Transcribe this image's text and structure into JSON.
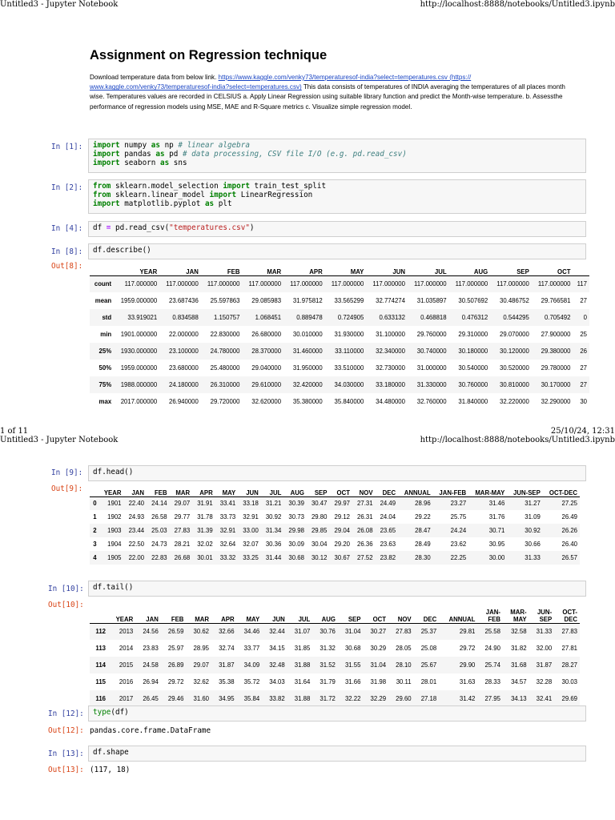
{
  "page1": {
    "header_left": "Untitled3 - Jupyter Notebook",
    "header_right": "http://localhost:8888/notebooks/Untitled3.ipynb",
    "footer_left": "1 of 11",
    "footer_right": "25/10/24, 12:31"
  },
  "page2": {
    "header_left": "Untitled3 - Jupyter Notebook",
    "header_right": "http://localhost:8888/notebooks/Untitled3.ipynb"
  },
  "markdown": {
    "title": "Assignment on Regression technique",
    "desc_prefix": "Download temperature data from below link. ",
    "link1": "https://www.kaggle.com/venky73/temperaturesof-india?select=temperatures.csv (https://",
    "link2": "www.kaggle.com/venky73/temperaturesof-india?select=temperatures.csv)",
    "desc_suffix": " This data consists of temperatures of INDIA averaging the temperatures of all places month wise. Temperatures values are recorded in CELSIUS a. Apply Linear Regression using suitable library function and predict the Month-wise temperature. b. Assessthe performance of regression models using MSE, MAE and R-Square metrics c. Visualize simple regression model."
  },
  "prompts": {
    "in1": "In [1]:",
    "in2": "In [2]:",
    "in4": "In [4]:",
    "in8": "In [8]:",
    "out8": "Out[8]:",
    "in9": "In [9]:",
    "out9": "Out[9]:",
    "in10": "In [10]:",
    "out10": "Out[10]:",
    "in12": "In [12]:",
    "out12": "Out[12]:",
    "in13": "In [13]:",
    "out13": "Out[13]:"
  },
  "code": {
    "c1": [
      {
        "kw1": "import",
        "a": " numpy ",
        "kw2": "as",
        "b": " np ",
        "comment": "# linear algebra"
      },
      {
        "kw1": "import",
        "a": " pandas ",
        "kw2": "as",
        "b": " pd ",
        "comment": "# data processing, CSV file I/O (e.g. pd.read_csv)"
      },
      {
        "kw1": "import",
        "a": " seaborn ",
        "kw2": "as",
        "b": " sns",
        "comment": ""
      }
    ],
    "c2": [
      {
        "kw1": "from",
        "a": " sklearn.model_selection ",
        "kw2": "import",
        "b": " train_test_split"
      },
      {
        "kw1": "from",
        "a": " sklearn.linear_model ",
        "kw2": "import",
        "b": " LinearRegression"
      },
      {
        "kw1": "import",
        "a": " matplotlib.pyplot ",
        "kw2": "as",
        "b": " plt"
      }
    ],
    "c4_a": "df ",
    "c4_op": "=",
    "c4_b": " pd.read_csv(",
    "c4_str": "\"temperatures.csv\"",
    "c4_c": ")",
    "c8": "df.describe()",
    "c9": "df.head()",
    "c10": "df.tail()",
    "c12_fn": "type",
    "c12_b": "(df)",
    "c13": "df.shape"
  },
  "outputs": {
    "out12": "pandas.core.frame.DataFrame",
    "out13": "(117, 18)"
  },
  "describe": {
    "columns": [
      "",
      "YEAR",
      "JAN",
      "FEB",
      "MAR",
      "APR",
      "MAY",
      "JUN",
      "JUL",
      "AUG",
      "SEP",
      "OCT",
      ""
    ],
    "rows": [
      [
        "count",
        "117.000000",
        "117.000000",
        "117.000000",
        "117.000000",
        "117.000000",
        "117.000000",
        "117.000000",
        "117.000000",
        "117.000000",
        "117.000000",
        "117.000000",
        "117"
      ],
      [
        "mean",
        "1959.000000",
        "23.687436",
        "25.597863",
        "29.085983",
        "31.975812",
        "33.565299",
        "32.774274",
        "31.035897",
        "30.507692",
        "30.486752",
        "29.766581",
        "27"
      ],
      [
        "std",
        "33.919021",
        "0.834588",
        "1.150757",
        "1.068451",
        "0.889478",
        "0.724905",
        "0.633132",
        "0.468818",
        "0.476312",
        "0.544295",
        "0.705492",
        "0"
      ],
      [
        "min",
        "1901.000000",
        "22.000000",
        "22.830000",
        "26.680000",
        "30.010000",
        "31.930000",
        "31.100000",
        "29.760000",
        "29.310000",
        "29.070000",
        "27.900000",
        "25"
      ],
      [
        "25%",
        "1930.000000",
        "23.100000",
        "24.780000",
        "28.370000",
        "31.460000",
        "33.110000",
        "32.340000",
        "30.740000",
        "30.180000",
        "30.120000",
        "29.380000",
        "26"
      ],
      [
        "50%",
        "1959.000000",
        "23.680000",
        "25.480000",
        "29.040000",
        "31.950000",
        "33.510000",
        "32.730000",
        "31.000000",
        "30.540000",
        "30.520000",
        "29.780000",
        "27"
      ],
      [
        "75%",
        "1988.000000",
        "24.180000",
        "26.310000",
        "29.610000",
        "32.420000",
        "34.030000",
        "33.180000",
        "31.330000",
        "30.760000",
        "30.810000",
        "30.170000",
        "27"
      ],
      [
        "max",
        "2017.000000",
        "26.940000",
        "29.720000",
        "32.620000",
        "35.380000",
        "35.840000",
        "34.480000",
        "32.760000",
        "31.840000",
        "32.220000",
        "32.290000",
        "30"
      ]
    ]
  },
  "head": {
    "columns": [
      "",
      "YEAR",
      "JAN",
      "FEB",
      "MAR",
      "APR",
      "MAY",
      "JUN",
      "JUL",
      "AUG",
      "SEP",
      "OCT",
      "NOV",
      "DEC",
      "ANNUAL",
      "JAN-FEB",
      "MAR-MAY",
      "JUN-SEP",
      "OCT-DEC"
    ],
    "rows": [
      [
        "0",
        "1901",
        "22.40",
        "24.14",
        "29.07",
        "31.91",
        "33.41",
        "33.18",
        "31.21",
        "30.39",
        "30.47",
        "29.97",
        "27.31",
        "24.49",
        "28.96",
        "23.27",
        "31.46",
        "31.27",
        "27.25"
      ],
      [
        "1",
        "1902",
        "24.93",
        "26.58",
        "29.77",
        "31.78",
        "33.73",
        "32.91",
        "30.92",
        "30.73",
        "29.80",
        "29.12",
        "26.31",
        "24.04",
        "29.22",
        "25.75",
        "31.76",
        "31.09",
        "26.49"
      ],
      [
        "2",
        "1903",
        "23.44",
        "25.03",
        "27.83",
        "31.39",
        "32.91",
        "33.00",
        "31.34",
        "29.98",
        "29.85",
        "29.04",
        "26.08",
        "23.65",
        "28.47",
        "24.24",
        "30.71",
        "30.92",
        "26.26"
      ],
      [
        "3",
        "1904",
        "22.50",
        "24.73",
        "28.21",
        "32.02",
        "32.64",
        "32.07",
        "30.36",
        "30.09",
        "30.04",
        "29.20",
        "26.36",
        "23.63",
        "28.49",
        "23.62",
        "30.95",
        "30.66",
        "26.40"
      ],
      [
        "4",
        "1905",
        "22.00",
        "22.83",
        "26.68",
        "30.01",
        "33.32",
        "33.25",
        "31.44",
        "30.68",
        "30.12",
        "30.67",
        "27.52",
        "23.82",
        "28.30",
        "22.25",
        "30.00",
        "31.33",
        "26.57"
      ]
    ]
  },
  "tail": {
    "columns": [
      "",
      "YEAR",
      "JAN",
      "FEB",
      "MAR",
      "APR",
      "MAY",
      "JUN",
      "JUL",
      "AUG",
      "SEP",
      "OCT",
      "NOV",
      "DEC",
      "ANNUAL",
      "JAN-\nFEB",
      "MAR-\nMAY",
      "JUN-\nSEP",
      "OCT-\nDEC"
    ],
    "rows": [
      [
        "112",
        "2013",
        "24.56",
        "26.59",
        "30.62",
        "32.66",
        "34.46",
        "32.44",
        "31.07",
        "30.76",
        "31.04",
        "30.27",
        "27.83",
        "25.37",
        "29.81",
        "25.58",
        "32.58",
        "31.33",
        "27.83"
      ],
      [
        "113",
        "2014",
        "23.83",
        "25.97",
        "28.95",
        "32.74",
        "33.77",
        "34.15",
        "31.85",
        "31.32",
        "30.68",
        "30.29",
        "28.05",
        "25.08",
        "29.72",
        "24.90",
        "31.82",
        "32.00",
        "27.81"
      ],
      [
        "114",
        "2015",
        "24.58",
        "26.89",
        "29.07",
        "31.87",
        "34.09",
        "32.48",
        "31.88",
        "31.52",
        "31.55",
        "31.04",
        "28.10",
        "25.67",
        "29.90",
        "25.74",
        "31.68",
        "31.87",
        "28.27"
      ],
      [
        "115",
        "2016",
        "26.94",
        "29.72",
        "32.62",
        "35.38",
        "35.72",
        "34.03",
        "31.64",
        "31.79",
        "31.66",
        "31.98",
        "30.11",
        "28.01",
        "31.63",
        "28.33",
        "34.57",
        "32.28",
        "30.03"
      ],
      [
        "116",
        "2017",
        "26.45",
        "29.46",
        "31.60",
        "34.95",
        "35.84",
        "33.82",
        "31.88",
        "31.72",
        "32.22",
        "32.29",
        "29.60",
        "27.18",
        "31.42",
        "27.95",
        "34.13",
        "32.41",
        "29.69"
      ]
    ]
  }
}
